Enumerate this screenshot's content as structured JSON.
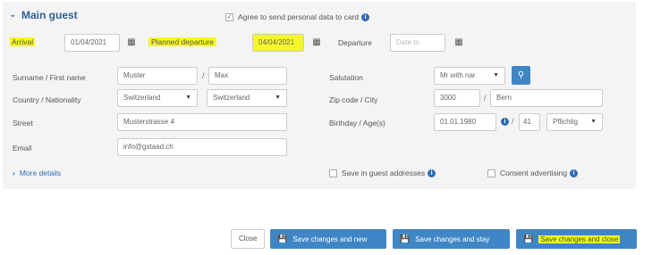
{
  "section": {
    "title": "Main guest",
    "chevron_icon": "chevron-down-icon"
  },
  "agree": {
    "label": "Agree to send personal data to card",
    "checked": true
  },
  "arrival": {
    "label": "Arrival",
    "value": "01/04/2021",
    "icon": "calendar-icon"
  },
  "planned_departure": {
    "label": "Planned departure",
    "value": "04/04/2021",
    "icon": "calendar-icon"
  },
  "departure": {
    "label": "Departure",
    "placeholder": "Date to",
    "icon": "calendar-icon"
  },
  "name": {
    "label": "Surname / First name",
    "surname": "Muster",
    "first_name": "Max",
    "separator": "/"
  },
  "salutation": {
    "label": "Salutation",
    "value": "Mr with nar",
    "search_icon": "search-icon"
  },
  "country": {
    "label": "Country / Nationality",
    "country": "Switzerland",
    "nationality": "Switzerland"
  },
  "zip_city": {
    "label": "Zip code / City",
    "zip": "3000",
    "city": "Bern",
    "separator": "/"
  },
  "street": {
    "label": "Street",
    "value": "Musterstrasse 4"
  },
  "birthday": {
    "label": "Birthday / Age(s)",
    "date": "01.01.1980",
    "age": "41",
    "option": "Pflichtig",
    "separator": "/"
  },
  "email": {
    "label": "Email",
    "value": "info@gstaad.ch"
  },
  "more_details": {
    "label": "More details",
    "icon": "chevron-right-icon"
  },
  "save_guest": {
    "label": "Save in guest addresses"
  },
  "consent": {
    "label": "Consent advertising"
  },
  "buttons": {
    "close": "Close",
    "save_new": "Save changes and new",
    "save_stay": "Save changes and stay",
    "save_close": "Save changes and close"
  },
  "colors": {
    "accent": "#3f86c6",
    "highlight": "#f6f62a",
    "panel": "#f4f4f4"
  }
}
